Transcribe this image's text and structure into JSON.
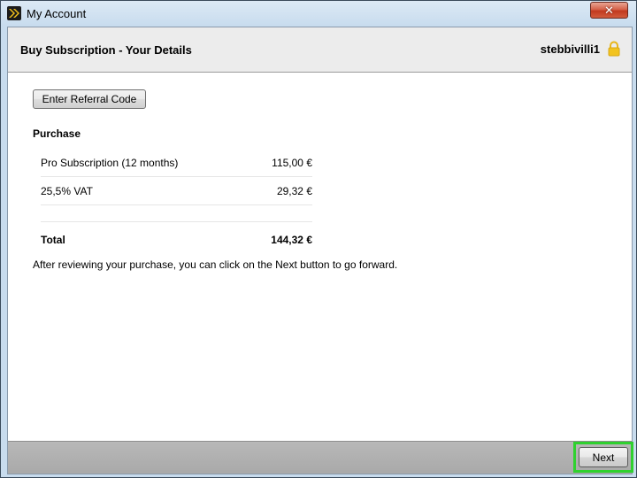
{
  "window": {
    "title": "My Account",
    "close_label": "✕"
  },
  "header": {
    "title": "Buy Subscription - Your Details",
    "username": "stebbivilli1"
  },
  "referral_button": "Enter Referral Code",
  "purchase": {
    "title": "Purchase",
    "items": [
      {
        "label": "Pro Subscription (12 months)",
        "value": "115,00 €"
      },
      {
        "label": "25,5% VAT",
        "value": "29,32 €"
      }
    ],
    "total": {
      "label": "Total",
      "value": "144,32 €"
    }
  },
  "info_text": "After reviewing your purchase, you can click on the Next button to go forward.",
  "footer": {
    "next_label": "Next"
  },
  "colors": {
    "highlight": "#2fd12f",
    "lock": "#f2c31f"
  }
}
